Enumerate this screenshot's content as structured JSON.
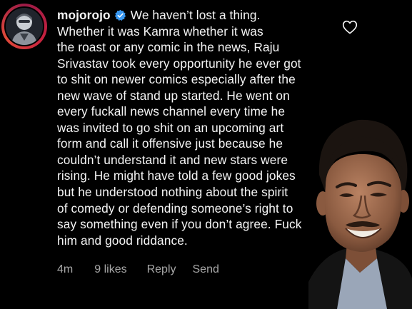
{
  "comment": {
    "username": "mojorojo",
    "lines": [
      "We haven’t lost a thing.",
      "Whether it was Kamra whether it was",
      "the roast or any comic in the news, Raju",
      "Srivastav took every opportunity he ever got",
      "to shit on newer comics especially after the",
      "new wave of stand up started. He went on",
      "every fuckall news channel every time he",
      "was invited to go shit on an upcoming art",
      "form and call it offensive just because he",
      "couldn’t understand it and new stars were",
      "rising. He might have told a few good jokes",
      "but he understood nothing about the spirit",
      "of comedy or defending someone’s right to",
      "say something even if you don’t agree. Fuck",
      "him and good riddance."
    ],
    "time": "4m",
    "likes": "9 likes",
    "reply_label": "Reply",
    "send_label": "Send"
  },
  "icons": {
    "verified": "verified-badge-icon",
    "like": "heart-icon"
  },
  "colors": {
    "background": "#000000",
    "text": "#f5f5f5",
    "meta_text": "#a8a8a8",
    "verified_blue": "#3897f0"
  }
}
